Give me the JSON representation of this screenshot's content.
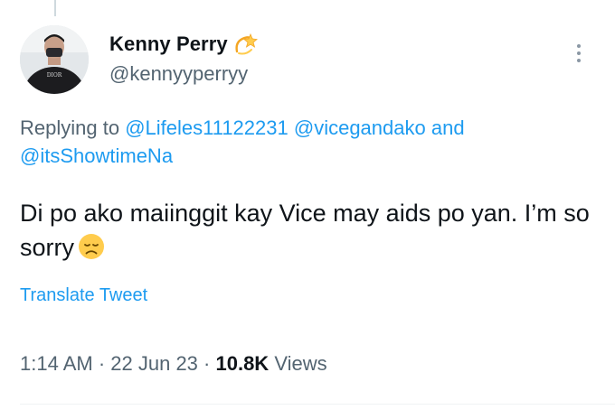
{
  "user": {
    "display_name": "Kenny Perry",
    "name_emoji": "dizzy-emoji",
    "handle": "@kennyyperryy",
    "avatar_shirt_text": "DIOR"
  },
  "reply": {
    "prefix": "Replying to ",
    "mention_1": "@Lifeles11122231",
    "mention_2": "@vicegandako",
    "joiner": " and",
    "mention_3": "@itsShowtimeNa"
  },
  "tweet": {
    "text": "Di po ako maiinggit kay Vice may aids po yan. I’m so sorry",
    "emoji": "disappointed-face-emoji"
  },
  "translate_label": "Translate Tweet",
  "meta": {
    "time": "1:14 AM",
    "separator": " · ",
    "date": "22 Jun 23",
    "views_count": "10.8K",
    "views_label": " Views"
  },
  "colors": {
    "accent": "#1d9bf0",
    "secondary_text": "#536471",
    "primary_text": "#0f1419"
  }
}
